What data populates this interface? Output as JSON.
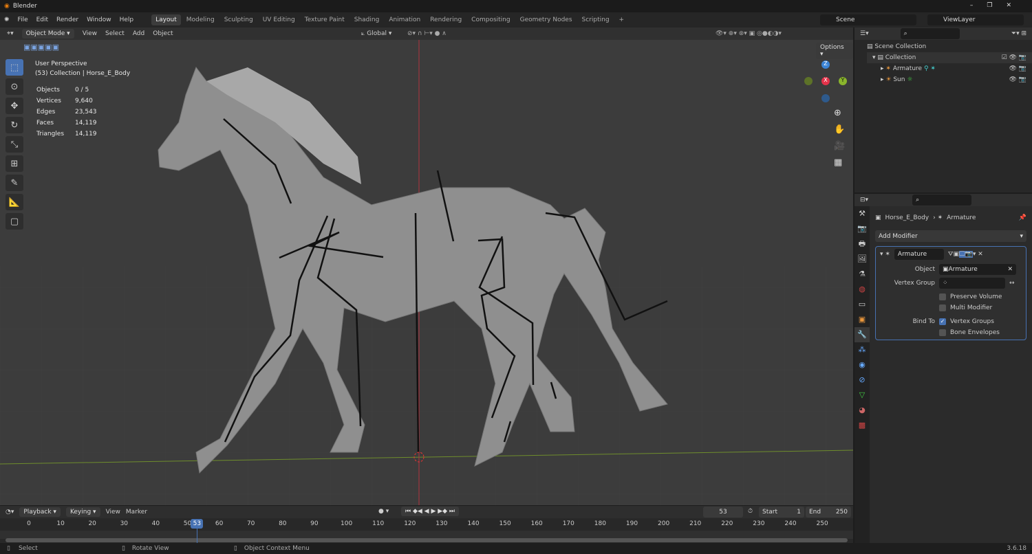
{
  "app": {
    "title": "Blender",
    "version": "3.6.18"
  },
  "menu": [
    "File",
    "Edit",
    "Render",
    "Window",
    "Help"
  ],
  "workspaces": [
    "Layout",
    "Modeling",
    "Sculpting",
    "UV Editing",
    "Texture Paint",
    "Shading",
    "Animation",
    "Rendering",
    "Compositing",
    "Geometry Nodes",
    "Scripting"
  ],
  "active_workspace": "Layout",
  "scene": "Scene",
  "view_layer": "ViewLayer",
  "viewport_header": {
    "mode": "Object Mode",
    "menus": [
      "View",
      "Select",
      "Add",
      "Object"
    ],
    "orientation": "Global",
    "options": "Options"
  },
  "overlay": {
    "perspective": "User Perspective",
    "collection": "(53) Collection | Horse_E_Body",
    "stats": [
      {
        "label": "Objects",
        "value": "0 / 5"
      },
      {
        "label": "Vertices",
        "value": "9,640"
      },
      {
        "label": "Edges",
        "value": "23,543"
      },
      {
        "label": "Faces",
        "value": "14,119"
      },
      {
        "label": "Triangles",
        "value": "14,119"
      }
    ]
  },
  "gizmo": {
    "x": "X",
    "y": "Y",
    "z": "Z"
  },
  "outliner": {
    "root": "Scene Collection",
    "collection": "Collection",
    "items": [
      "Armature",
      "Sun"
    ]
  },
  "properties": {
    "breadcrumb_object": "Horse_E_Body",
    "breadcrumb_modifier": "Armature",
    "add_modifier": "Add Modifier",
    "modifier": {
      "name": "Armature",
      "object_label": "Object",
      "object_value": "Armature",
      "vertex_group_label": "Vertex Group",
      "preserve_volume": "Preserve Volume",
      "multi_modifier": "Multi Modifier",
      "bind_to_label": "Bind To",
      "vertex_groups": "Vertex Groups",
      "bone_envelopes": "Bone Envelopes",
      "vertex_groups_checked": true,
      "preserve_volume_checked": false,
      "multi_modifier_checked": false,
      "bone_envelopes_checked": false
    }
  },
  "timeline": {
    "menus": [
      "Playback",
      "Keying",
      "View",
      "Marker"
    ],
    "current_frame": "53",
    "start_label": "Start",
    "start": "1",
    "end_label": "End",
    "end": "250",
    "ticks": [
      "0",
      "10",
      "20",
      "30",
      "40",
      "50",
      "60",
      "70",
      "80",
      "90",
      "100",
      "110",
      "120",
      "130",
      "140",
      "150",
      "160",
      "170",
      "180",
      "190",
      "200",
      "210",
      "220",
      "230",
      "240",
      "250"
    ]
  },
  "statusbar": [
    "Select",
    "Rotate View",
    "Object Context Menu"
  ],
  "colors": {
    "accent": "#4772b3",
    "x_axis": "#e3324a",
    "y_axis": "#8ab52c",
    "z_axis": "#3b84d6"
  }
}
